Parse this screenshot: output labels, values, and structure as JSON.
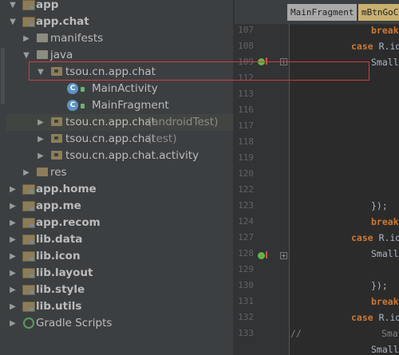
{
  "project_tree": {
    "items": [
      {
        "label": "app"
      },
      {
        "label": "app.chat"
      },
      {
        "label": "manifests"
      },
      {
        "label": "java"
      },
      {
        "label": "tsou.cn.app.chat"
      },
      {
        "label": "MainActivity"
      },
      {
        "label": "MainFragment"
      },
      {
        "label": "tsou.cn.app.chat",
        "suffix": "(androidTest)"
      },
      {
        "label": "tsou.cn.app.chat",
        "suffix": "(test)"
      },
      {
        "label": "tsou.cn.app.chat.activity"
      },
      {
        "label": "res"
      },
      {
        "label": "app.home"
      },
      {
        "label": "app.me"
      },
      {
        "label": "app.recom"
      },
      {
        "label": "lib.data"
      },
      {
        "label": "lib.icon"
      },
      {
        "label": "lib.layout"
      },
      {
        "label": "lib.style"
      },
      {
        "label": "lib.utils"
      },
      {
        "label": "Gradle Scripts"
      }
    ],
    "class_icon_letter": "C"
  },
  "editor": {
    "tabs": [
      {
        "label": "MainFragment"
      },
      {
        "label": "mBtnGoCl"
      }
    ],
    "line_numbers": [
      "107",
      "108",
      "109",
      "112",
      "113",
      "116",
      "117",
      "118",
      "119",
      "120",
      "122",
      "123",
      "124",
      "127",
      "128",
      "129",
      "130",
      "131",
      "132",
      "133"
    ],
    "code": {
      "break1": "break",
      "case1": "case",
      "case1_rest": " R.id.",
      "small1": "Small.",
      "close1": "});",
      "break2": "break",
      "case2": "case",
      "case2_rest": " R.id.",
      "small2": "Small.",
      "close2": "});",
      "break3": "break",
      "case3": "case",
      "case3_rest": " R.id.",
      "comment": "//",
      "small3": "Small",
      "small4": "Small."
    }
  },
  "colors": {
    "panel_bg": "#3c3f41",
    "editor_bg": "#2b2b2b",
    "highlight_box": "#d43b3b",
    "keyword": "#cc7832"
  }
}
